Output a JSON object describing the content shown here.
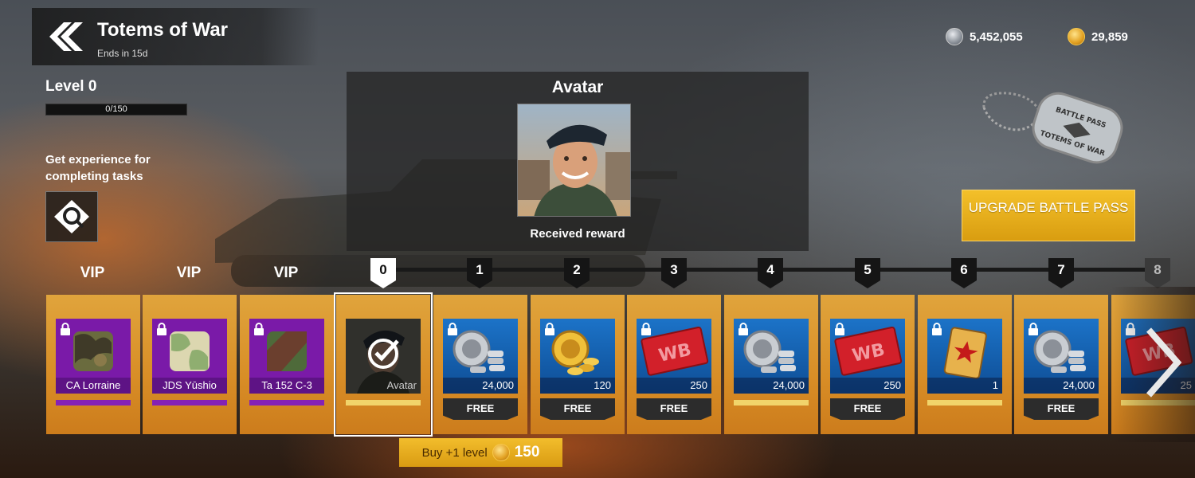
{
  "header": {
    "title": "Totems of War",
    "subtitle": "Ends in 15d"
  },
  "currency": {
    "silver": "5,452,055",
    "gold": "29,859"
  },
  "progress": {
    "level_label": "Level 0",
    "xp_text": "0/150",
    "xp_fraction": 0,
    "tasks_text": "Get experience for completing tasks"
  },
  "reward_preview": {
    "title": "Avatar",
    "status": "Received reward"
  },
  "upgrade": {
    "label": "UPGRADE BATTLE PASS"
  },
  "track": {
    "vip_labels": [
      "VIP",
      "VIP",
      "VIP"
    ],
    "levels": [
      "0",
      "1",
      "2",
      "3",
      "4",
      "5",
      "6",
      "7",
      "8"
    ],
    "vip_items": [
      {
        "name": "CA Lorraine",
        "icon": "camo-icon"
      },
      {
        "name": "JDS Yūshio",
        "icon": "camo-icon"
      },
      {
        "name": "Ta 152 C-3",
        "icon": "camo-icon"
      }
    ],
    "current_item": {
      "name": "Avatar",
      "icon": "claimed-check-icon"
    },
    "free_label": "FREE",
    "rewards": [
      {
        "level": "1",
        "amount": "24,000",
        "icon": "silver-coins-icon",
        "free": true
      },
      {
        "level": "2",
        "amount": "120",
        "icon": "gold-coins-icon",
        "free": true
      },
      {
        "level": "3",
        "amount": "250",
        "icon": "wb-ticket-icon",
        "free": true
      },
      {
        "level": "4",
        "amount": "24,000",
        "icon": "silver-coins-icon",
        "free": false
      },
      {
        "level": "5",
        "amount": "250",
        "icon": "wb-ticket-icon",
        "free": true
      },
      {
        "level": "6",
        "amount": "1",
        "icon": "card-icon",
        "free": false
      },
      {
        "level": "7",
        "amount": "24,000",
        "icon": "silver-coins-icon",
        "free": true
      },
      {
        "level": "8",
        "amount": "25",
        "icon": "wb-ticket-icon",
        "free": false
      }
    ]
  },
  "buy": {
    "label": "Buy +1 level",
    "cost": "150"
  }
}
